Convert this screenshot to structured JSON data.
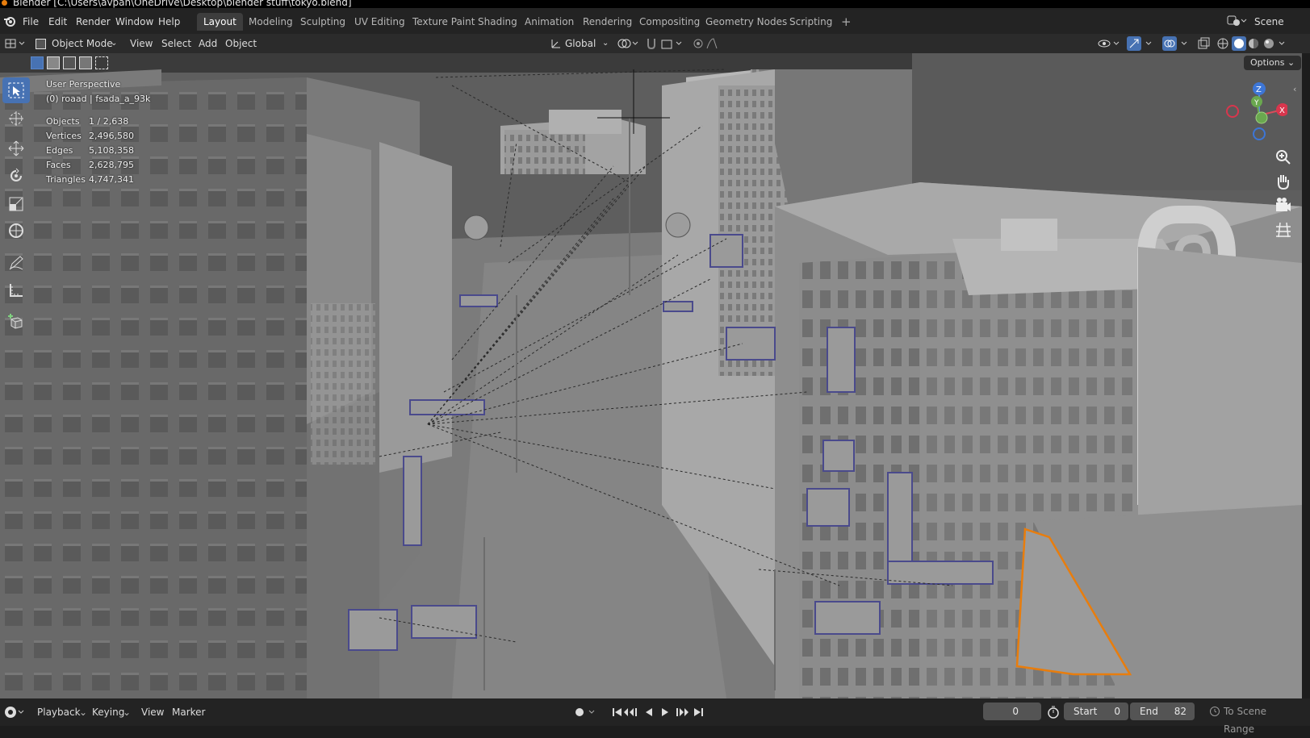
{
  "window": {
    "title": "Blender [C:\\Users\\avpan\\OneDrive\\Desktop\\blender stuff\\tokyo.blend]"
  },
  "menu": [
    "File",
    "Edit",
    "Render",
    "Window",
    "Help"
  ],
  "workspaces": [
    "Layout",
    "Modeling",
    "Sculpting",
    "UV Editing",
    "Texture Paint",
    "Shading",
    "Animation",
    "Rendering",
    "Compositing",
    "Geometry Nodes",
    "Scripting"
  ],
  "active_workspace": "Layout",
  "scene": {
    "label": "Scene"
  },
  "header": {
    "mode": "Object Mode",
    "items": [
      "View",
      "Select",
      "Add",
      "Object"
    ],
    "orientation": "Global",
    "options": "Options"
  },
  "viewport": {
    "perspective": "User Perspective",
    "object_info": "(0) roaad | fsada_a_93k",
    "stats": [
      {
        "label": "Objects",
        "value": "1 / 2,638"
      },
      {
        "label": "Vertices",
        "value": "2,496,580"
      },
      {
        "label": "Edges",
        "value": "5,108,358"
      },
      {
        "label": "Faces",
        "value": "2,628,795"
      },
      {
        "label": "Triangles",
        "value": "4,747,341"
      }
    ],
    "gizmo": {
      "z": "Z",
      "y": "Y",
      "x": "X"
    }
  },
  "colors": {
    "accent": "#4772b3",
    "selection": "#e87d0d",
    "background": "#232323"
  },
  "timeline": {
    "items": [
      "Playback",
      "Keying",
      "View",
      "Marker"
    ],
    "current_frame": "0",
    "start_label": "Start",
    "start": "0",
    "end_label": "End",
    "end": "82",
    "range_label": "To Scene Range"
  }
}
